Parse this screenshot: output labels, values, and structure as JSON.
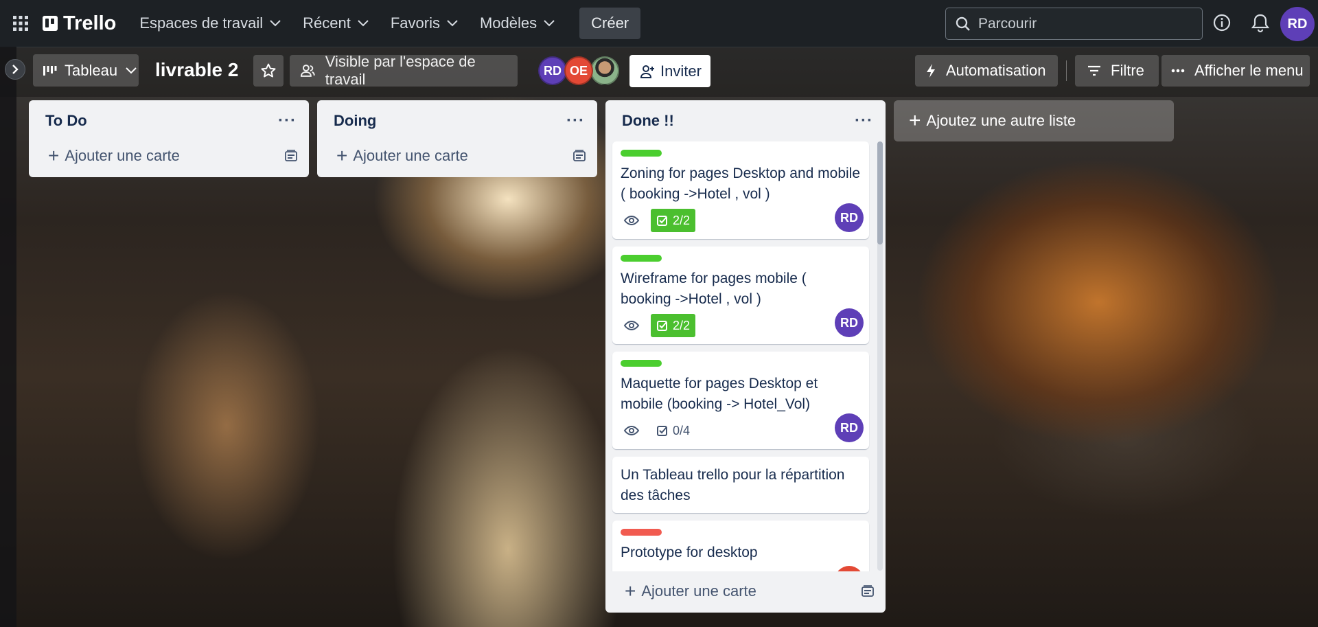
{
  "topnav": {
    "brand": "Trello",
    "menu": [
      {
        "label": "Espaces de travail"
      },
      {
        "label": "Récent"
      },
      {
        "label": "Favoris"
      },
      {
        "label": "Modèles"
      }
    ],
    "create_label": "Créer",
    "search_placeholder": "Parcourir",
    "user_initials": "RD"
  },
  "board": {
    "view_label": "Tableau",
    "title": "livrable 2",
    "visibility_label": "Visible par l'espace de travail",
    "members": [
      "RD",
      "OE",
      ""
    ],
    "invite_label": "Inviter",
    "automation_label": "Automatisation",
    "filter_label": "Filtre",
    "menu_label": "Afficher le menu",
    "add_list_label": "Ajoutez une autre liste"
  },
  "lists": [
    {
      "title": "To Do",
      "add_card_label": "Ajouter une carte"
    },
    {
      "title": "Doing",
      "add_card_label": "Ajouter une carte"
    },
    {
      "title": "Done !!",
      "add_card_label": "Ajouter une carte",
      "cards": [
        {
          "title": "Zoning for pages Desktop and mobile ( booking ->Hotel , vol )",
          "label_color": "#4bce2f",
          "checklist": "2/2",
          "complete": true,
          "member": "RD"
        },
        {
          "title": "Wireframe for pages mobile ( booking ->Hotel , vol )",
          "label_color": "#4bce2f",
          "checklist": "2/2",
          "complete": true,
          "member": "RD"
        },
        {
          "title": "Maquette for pages Desktop et mobile (booking -> Hotel_Vol)",
          "label_color": "#4bce2f",
          "checklist": "0/4",
          "complete": false,
          "member": "RD"
        },
        {
          "title": "Un Tableau trello pour la répartition des tâches"
        },
        {
          "title": "Prototype for desktop",
          "label_color": "#f15b50"
        }
      ]
    }
  ],
  "colors": {
    "nav_bg": "#1d2125",
    "list_bg": "#f1f2f4",
    "green_label": "#4bce2f",
    "red_label": "#f15b50",
    "member_purple": "#5e3fb7",
    "member_red": "#e34935"
  },
  "icons": {
    "apps": "grid-icon",
    "search": "search-icon",
    "info": "info-icon",
    "notifications": "bell-icon",
    "star": "star-icon",
    "visibility": "people-icon",
    "automation": "lightning-icon",
    "filter": "filter-icon",
    "card_watch": "eye-icon",
    "checklist": "checkbox-icon"
  }
}
